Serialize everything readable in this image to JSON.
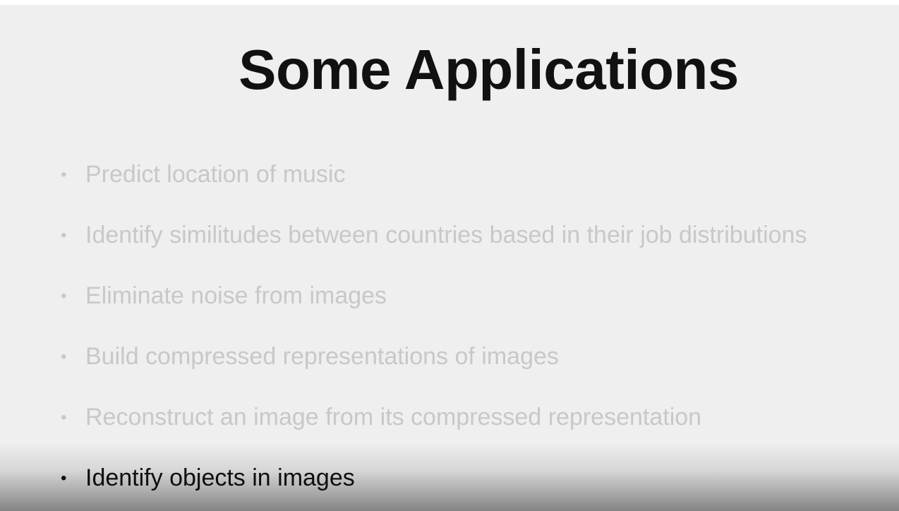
{
  "slide": {
    "title": "Some Applications",
    "bullet_marker": "•",
    "items": [
      {
        "text": "Predict location of music",
        "active": false
      },
      {
        "text": "Identify similitudes between countries based in their job distributions",
        "active": false
      },
      {
        "text": "Eliminate noise from images",
        "active": false
      },
      {
        "text": "Build compressed representations of images",
        "active": false
      },
      {
        "text": "Reconstruct an image from its compressed representation",
        "active": false
      },
      {
        "text": "Identify objects in images",
        "active": true
      }
    ]
  },
  "colors": {
    "background": "#efefef",
    "title": "#111111",
    "inactive_text": "#c8c8c8",
    "active_text": "#111111"
  }
}
